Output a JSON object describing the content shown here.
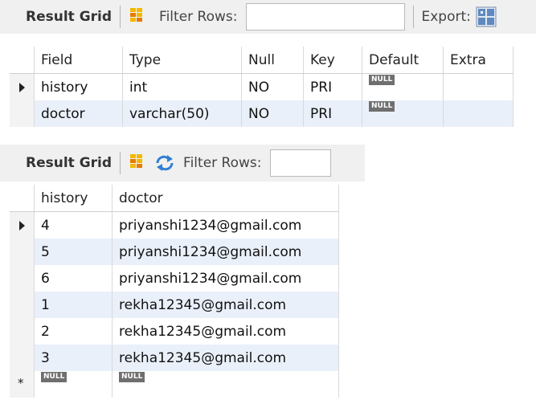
{
  "top_panel": {
    "toolbar": {
      "result_grid_label": "Result Grid",
      "filter_rows_label": "Filter Rows:",
      "filter_value": "",
      "export_label": "Export:"
    },
    "columns": [
      "Field",
      "Type",
      "Null",
      "Key",
      "Default",
      "Extra"
    ],
    "rows": [
      {
        "field": "history",
        "type": "int",
        "null": "NO",
        "key": "PRI",
        "default": "NULL",
        "extra": ""
      },
      {
        "field": "doctor",
        "type": "varchar(50)",
        "null": "NO",
        "key": "PRI",
        "default": "NULL",
        "extra": ""
      }
    ]
  },
  "bottom_panel": {
    "toolbar": {
      "result_grid_label": "Result Grid",
      "filter_rows_label": "Filter Rows:",
      "filter_value": ""
    },
    "columns": [
      "history",
      "doctor"
    ],
    "rows": [
      {
        "history": "4",
        "doctor": "priyanshi1234@gmail.com"
      },
      {
        "history": "5",
        "doctor": "priyanshi1234@gmail.com"
      },
      {
        "history": "6",
        "doctor": "priyanshi1234@gmail.com"
      },
      {
        "history": "1",
        "doctor": "rekha12345@gmail.com"
      },
      {
        "history": "2",
        "doctor": "rekha12345@gmail.com"
      },
      {
        "history": "3",
        "doctor": "rekha12345@gmail.com"
      }
    ],
    "new_row": {
      "history": "NULL",
      "doctor": "NULL"
    }
  },
  "colors": {
    "toolbar_bg": "#f0f0f0",
    "row_alt_bg": "#eaf0fa",
    "null_badge_bg": "#6f6f6f"
  },
  "icons": [
    "result-grid-icon",
    "refresh-icon",
    "save-export-icon",
    "current-row-arrow-icon",
    "new-row-star-icon"
  ]
}
